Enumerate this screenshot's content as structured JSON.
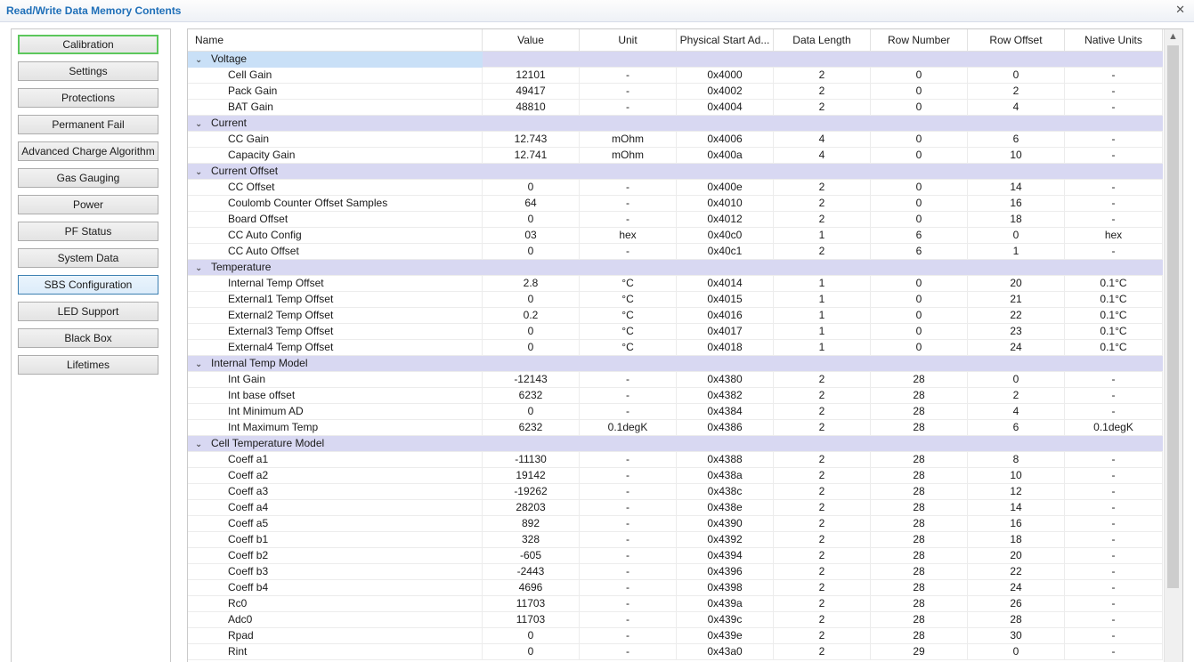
{
  "window": {
    "title": "Read/Write Data Memory Contents",
    "close_glyph": "✕"
  },
  "nav": [
    {
      "label": "Calibration",
      "state": "selected"
    },
    {
      "label": "Settings"
    },
    {
      "label": "Protections"
    },
    {
      "label": "Permanent Fail"
    },
    {
      "label": "Advanced Charge Algorithm"
    },
    {
      "label": "Gas Gauging"
    },
    {
      "label": "Power"
    },
    {
      "label": "PF Status"
    },
    {
      "label": "System Data"
    },
    {
      "label": "SBS Configuration",
      "state": "focused"
    },
    {
      "label": "LED Support"
    },
    {
      "label": "Black Box"
    },
    {
      "label": "Lifetimes"
    }
  ],
  "columns": [
    "Name",
    "Value",
    "Unit",
    "Physical Start Ad...",
    "Data Length",
    "Row Number",
    "Row Offset",
    "Native Units"
  ],
  "groups": [
    {
      "name": "Voltage",
      "rows": [
        [
          "Cell Gain",
          "12101",
          "-",
          "0x4000",
          "2",
          "0",
          "0",
          "-"
        ],
        [
          "Pack Gain",
          "49417",
          "-",
          "0x4002",
          "2",
          "0",
          "2",
          "-"
        ],
        [
          "BAT Gain",
          "48810",
          "-",
          "0x4004",
          "2",
          "0",
          "4",
          "-"
        ]
      ]
    },
    {
      "name": "Current",
      "rows": [
        [
          "CC Gain",
          "12.743",
          "mOhm",
          "0x4006",
          "4",
          "0",
          "6",
          "-"
        ],
        [
          "Capacity Gain",
          "12.741",
          "mOhm",
          "0x400a",
          "4",
          "0",
          "10",
          "-"
        ]
      ]
    },
    {
      "name": "Current Offset",
      "rows": [
        [
          "CC Offset",
          "0",
          "-",
          "0x400e",
          "2",
          "0",
          "14",
          "-"
        ],
        [
          "Coulomb Counter Offset Samples",
          "64",
          "-",
          "0x4010",
          "2",
          "0",
          "16",
          "-"
        ],
        [
          "Board Offset",
          "0",
          "-",
          "0x4012",
          "2",
          "0",
          "18",
          "-"
        ],
        [
          "CC Auto Config",
          "03",
          "hex",
          "0x40c0",
          "1",
          "6",
          "0",
          "hex"
        ],
        [
          "CC Auto Offset",
          "0",
          "-",
          "0x40c1",
          "2",
          "6",
          "1",
          "-"
        ]
      ]
    },
    {
      "name": "Temperature",
      "rows": [
        [
          "Internal Temp Offset",
          "2.8",
          "°C",
          "0x4014",
          "1",
          "0",
          "20",
          "0.1°C"
        ],
        [
          "External1 Temp Offset",
          "0",
          "°C",
          "0x4015",
          "1",
          "0",
          "21",
          "0.1°C"
        ],
        [
          "External2 Temp Offset",
          "0.2",
          "°C",
          "0x4016",
          "1",
          "0",
          "22",
          "0.1°C"
        ],
        [
          "External3 Temp Offset",
          "0",
          "°C",
          "0x4017",
          "1",
          "0",
          "23",
          "0.1°C"
        ],
        [
          "External4 Temp Offset",
          "0",
          "°C",
          "0x4018",
          "1",
          "0",
          "24",
          "0.1°C"
        ]
      ]
    },
    {
      "name": "Internal Temp Model",
      "rows": [
        [
          "Int Gain",
          "-12143",
          "-",
          "0x4380",
          "2",
          "28",
          "0",
          "-"
        ],
        [
          "Int base offset",
          "6232",
          "-",
          "0x4382",
          "2",
          "28",
          "2",
          "-"
        ],
        [
          "Int Minimum AD",
          "0",
          "-",
          "0x4384",
          "2",
          "28",
          "4",
          "-"
        ],
        [
          "Int Maximum Temp",
          "6232",
          "0.1degK",
          "0x4386",
          "2",
          "28",
          "6",
          "0.1degK"
        ]
      ]
    },
    {
      "name": "Cell Temperature Model",
      "rows": [
        [
          "Coeff a1",
          "-11130",
          "-",
          "0x4388",
          "2",
          "28",
          "8",
          "-"
        ],
        [
          "Coeff a2",
          "19142",
          "-",
          "0x438a",
          "2",
          "28",
          "10",
          "-"
        ],
        [
          "Coeff a3",
          "-19262",
          "-",
          "0x438c",
          "2",
          "28",
          "12",
          "-"
        ],
        [
          "Coeff a4",
          "28203",
          "-",
          "0x438e",
          "2",
          "28",
          "14",
          "-"
        ],
        [
          "Coeff a5",
          "892",
          "-",
          "0x4390",
          "2",
          "28",
          "16",
          "-"
        ],
        [
          "Coeff b1",
          "328",
          "-",
          "0x4392",
          "2",
          "28",
          "18",
          "-"
        ],
        [
          "Coeff b2",
          "-605",
          "-",
          "0x4394",
          "2",
          "28",
          "20",
          "-"
        ],
        [
          "Coeff b3",
          "-2443",
          "-",
          "0x4396",
          "2",
          "28",
          "22",
          "-"
        ],
        [
          "Coeff b4",
          "4696",
          "-",
          "0x4398",
          "2",
          "28",
          "24",
          "-"
        ],
        [
          "Rc0",
          "11703",
          "-",
          "0x439a",
          "2",
          "28",
          "26",
          "-"
        ],
        [
          "Adc0",
          "11703",
          "-",
          "0x439c",
          "2",
          "28",
          "28",
          "-"
        ],
        [
          "Rpad",
          "0",
          "-",
          "0x439e",
          "2",
          "28",
          "30",
          "-"
        ],
        [
          "Rint",
          "0",
          "-",
          "0x43a0",
          "2",
          "29",
          "0",
          "-"
        ]
      ]
    }
  ],
  "icons": {
    "expand": "chevron-down-icon",
    "scroll_up": "arrow-up-icon"
  }
}
